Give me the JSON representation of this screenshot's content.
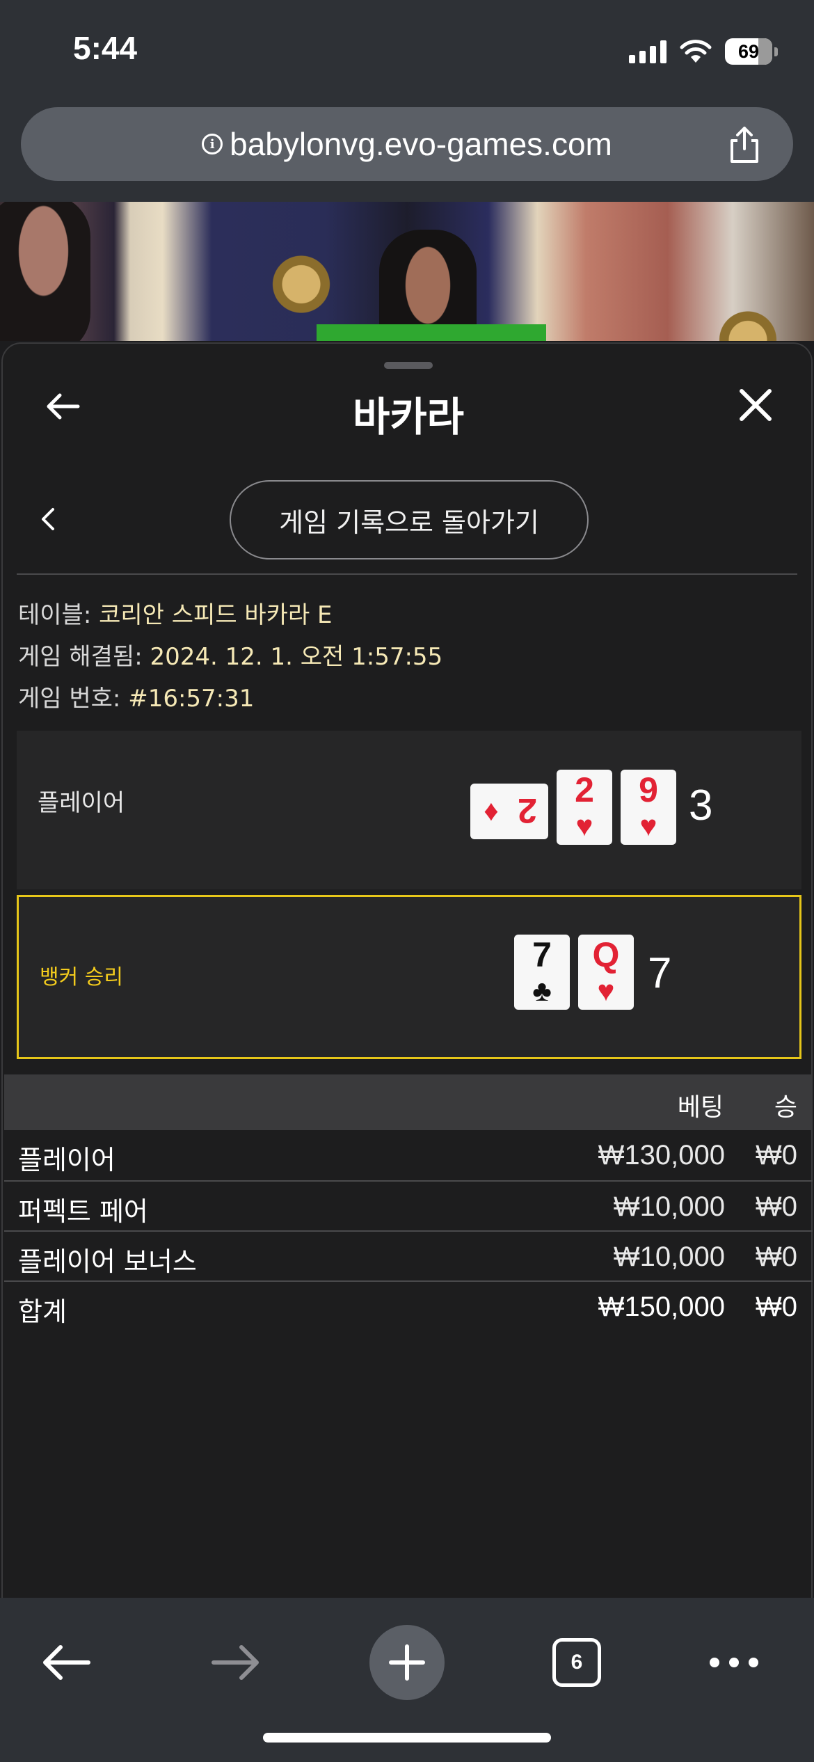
{
  "status_bar": {
    "time": "5:44",
    "battery": "69"
  },
  "browser": {
    "url": "babylonvg.evo-games.com",
    "tabs_count": "6"
  },
  "panel": {
    "title": "바카라",
    "back_to_history": "게임 기록으로 돌아가기",
    "info": [
      {
        "label": "테이블: ",
        "value": "코리안 스피드 바카라 E"
      },
      {
        "label": "게임 해결됨: ",
        "value": "2024. 12. 1. 오전 1:57:55"
      },
      {
        "label": "게임 번호: ",
        "value": "#16:57:31"
      }
    ],
    "player": {
      "label": "플레이어",
      "score": "3",
      "cards": [
        {
          "rank": "2",
          "suit": "♦",
          "color": "red",
          "rotated": true
        },
        {
          "rank": "2",
          "suit": "♥",
          "color": "red",
          "rotated": false
        },
        {
          "rank": "9",
          "suit": "♥",
          "color": "red",
          "rotated": false
        }
      ]
    },
    "banker": {
      "label": "뱅커 승리",
      "score": "7",
      "cards": [
        {
          "rank": "7",
          "suit": "♣",
          "color": "black",
          "rotated": false
        },
        {
          "rank": "Q",
          "suit": "♥",
          "color": "red",
          "rotated": false
        }
      ]
    },
    "bets": {
      "headers": {
        "bet": "베팅",
        "win": "승"
      },
      "rows": [
        {
          "name": "플레이어",
          "bet": "₩130,000",
          "win": "₩0"
        },
        {
          "name": "퍼펙트 페어",
          "bet": "₩10,000",
          "win": "₩0"
        },
        {
          "name": "플레이어 보너스",
          "bet": "₩10,000",
          "win": "₩0"
        }
      ],
      "total": {
        "name": "합계",
        "bet": "₩150,000",
        "win": "₩0"
      }
    }
  },
  "colors": {
    "winner_highlight": "#e6c619",
    "info_value": "#f6e9b6",
    "card_red": "#e22234"
  }
}
